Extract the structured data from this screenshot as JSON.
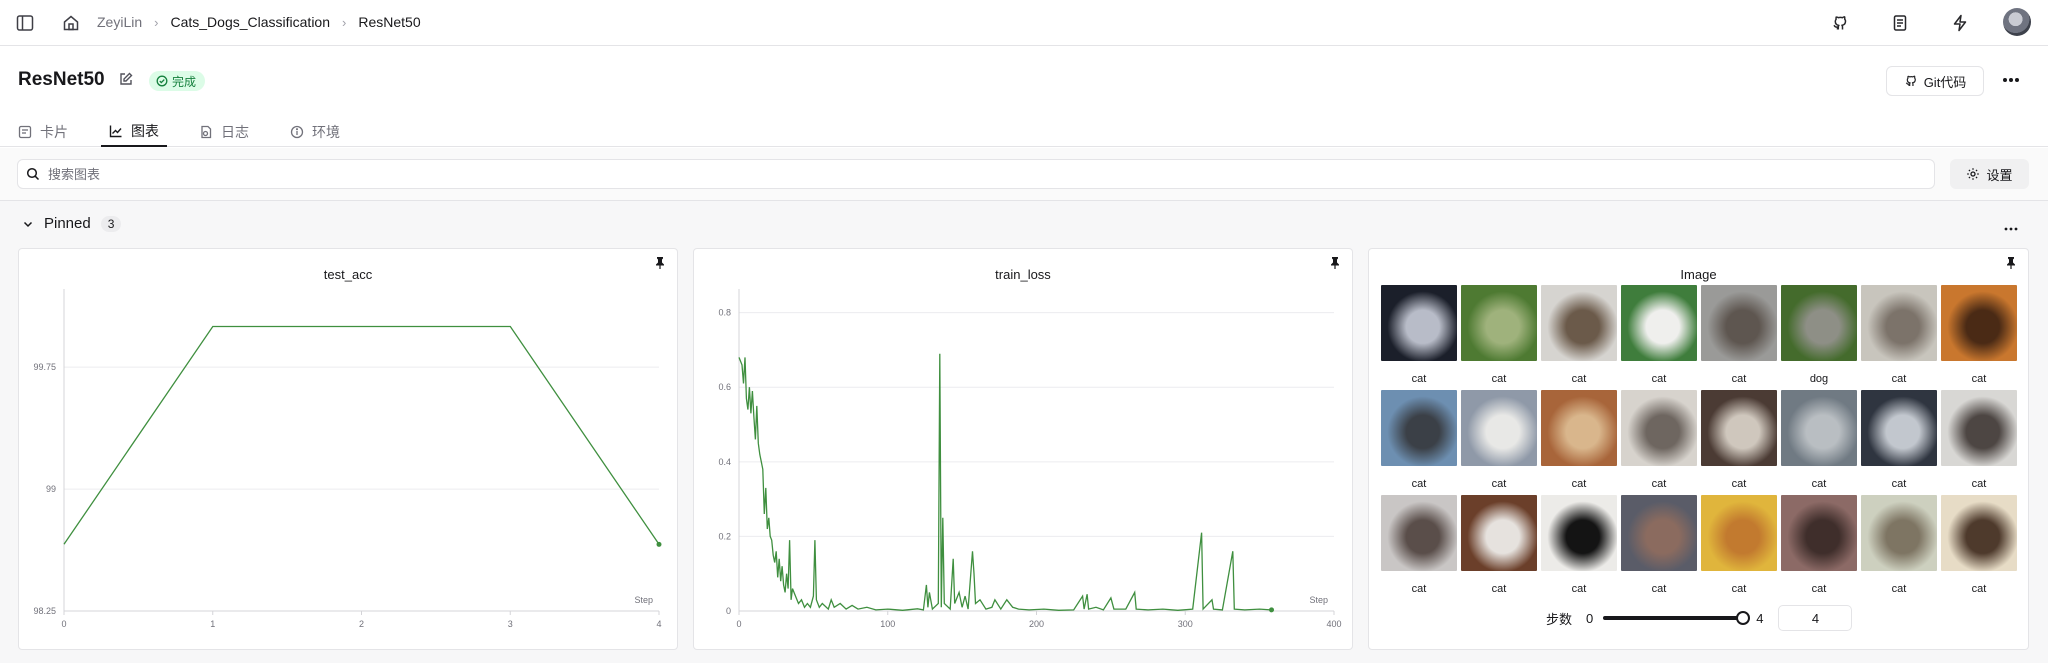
{
  "breadcrumb": {
    "user": "ZeyiLin",
    "project": "Cats_Dogs_Classification",
    "experiment": "ResNet50"
  },
  "header": {
    "title": "ResNet50",
    "status": "完成",
    "git_label": "Git代码"
  },
  "tabs": [
    {
      "label": "卡片"
    },
    {
      "label": "图表"
    },
    {
      "label": "日志"
    },
    {
      "label": "环境"
    }
  ],
  "search": {
    "placeholder": "搜索图表",
    "settings_label": "设置"
  },
  "section": {
    "title": "Pinned",
    "count": "3"
  },
  "colors": {
    "line": "#3f8f3f",
    "status_bg": "#dcfce7",
    "status_fg": "#15803d"
  },
  "chart_data": [
    {
      "type": "line",
      "title": "test_acc",
      "xlabel": "Step",
      "x": [
        0,
        1,
        2,
        3,
        4
      ],
      "y": [
        98.66,
        100.0,
        100.0,
        100.0,
        98.66
      ],
      "xlim": [
        0,
        4
      ],
      "ylim": [
        98.25,
        100.2
      ],
      "yticks": [
        "99.75",
        "99",
        "98.25"
      ],
      "xticks": [
        "0",
        "1",
        "2",
        "3",
        "4"
      ],
      "grid": true
    },
    {
      "type": "line",
      "title": "train_loss",
      "xlabel": "Step",
      "xlim": [
        0,
        400
      ],
      "ylim": [
        0,
        0.85
      ],
      "yticks": [
        "0.8",
        "0.6",
        "0.4",
        "0.2",
        "0"
      ],
      "xticks": [
        "0",
        "100",
        "200",
        "300",
        "400"
      ],
      "grid": true,
      "points": [
        [
          0,
          0.68
        ],
        [
          2,
          0.66
        ],
        [
          3,
          0.61
        ],
        [
          4,
          0.68
        ],
        [
          5,
          0.57
        ],
        [
          6,
          0.54
        ],
        [
          7,
          0.6
        ],
        [
          8,
          0.53
        ],
        [
          9,
          0.59
        ],
        [
          10,
          0.52
        ],
        [
          11,
          0.46
        ],
        [
          12,
          0.55
        ],
        [
          13,
          0.45
        ],
        [
          14,
          0.42
        ],
        [
          15,
          0.4
        ],
        [
          16,
          0.38
        ],
        [
          17,
          0.26
        ],
        [
          18,
          0.33
        ],
        [
          19,
          0.22
        ],
        [
          20,
          0.25
        ],
        [
          21,
          0.2
        ],
        [
          22,
          0.19
        ],
        [
          23,
          0.15
        ],
        [
          24,
          0.13
        ],
        [
          25,
          0.16
        ],
        [
          26,
          0.09
        ],
        [
          27,
          0.14
        ],
        [
          28,
          0.08
        ],
        [
          29,
          0.12
        ],
        [
          30,
          0.07
        ],
        [
          31,
          0.05
        ],
        [
          32,
          0.1
        ],
        [
          33,
          0.06
        ],
        [
          34,
          0.19
        ],
        [
          35,
          0.03
        ],
        [
          36,
          0.06
        ],
        [
          38,
          0.04
        ],
        [
          40,
          0.02
        ],
        [
          42,
          0.03
        ],
        [
          44,
          0.01
        ],
        [
          46,
          0.02
        ],
        [
          48,
          0.01
        ],
        [
          50,
          0.04
        ],
        [
          51,
          0.19
        ],
        [
          52,
          0.03
        ],
        [
          54,
          0.01
        ],
        [
          56,
          0.02
        ],
        [
          60,
          0.005
        ],
        [
          62,
          0.03
        ],
        [
          64,
          0.01
        ],
        [
          68,
          0.02
        ],
        [
          72,
          0.005
        ],
        [
          76,
          0.015
        ],
        [
          80,
          0.005
        ],
        [
          86,
          0.01
        ],
        [
          92,
          0.003
        ],
        [
          100,
          0.005
        ],
        [
          110,
          0.002
        ],
        [
          120,
          0.006
        ],
        [
          124,
          0.003
        ],
        [
          126,
          0.07
        ],
        [
          127,
          0.01
        ],
        [
          128,
          0.05
        ],
        [
          130,
          0.005
        ],
        [
          134,
          0.02
        ],
        [
          135,
          0.69
        ],
        [
          136,
          0.01
        ],
        [
          137,
          0.25
        ],
        [
          138,
          0.02
        ],
        [
          142,
          0.005
        ],
        [
          144,
          0.14
        ],
        [
          145,
          0.02
        ],
        [
          148,
          0.05
        ],
        [
          150,
          0.01
        ],
        [
          152,
          0.04
        ],
        [
          154,
          0.005
        ],
        [
          157,
          0.16
        ],
        [
          158,
          0.1
        ],
        [
          159,
          0.02
        ],
        [
          162,
          0.03
        ],
        [
          166,
          0.005
        ],
        [
          170,
          0.01
        ],
        [
          172,
          0.03
        ],
        [
          176,
          0.005
        ],
        [
          180,
          0.03
        ],
        [
          184,
          0.01
        ],
        [
          188,
          0.005
        ],
        [
          195,
          0.003
        ],
        [
          205,
          0.005
        ],
        [
          215,
          0.002
        ],
        [
          225,
          0.003
        ],
        [
          231,
          0.04
        ],
        [
          232,
          0.005
        ],
        [
          234,
          0.045
        ],
        [
          235,
          0.005
        ],
        [
          240,
          0.01
        ],
        [
          245,
          0.003
        ],
        [
          250,
          0.035
        ],
        [
          252,
          0.005
        ],
        [
          260,
          0.005
        ],
        [
          266,
          0.05
        ],
        [
          267,
          0.005
        ],
        [
          275,
          0.003
        ],
        [
          285,
          0.005
        ],
        [
          295,
          0.002
        ],
        [
          305,
          0.005
        ],
        [
          311,
          0.21
        ],
        [
          312,
          0.005
        ],
        [
          318,
          0.03
        ],
        [
          319,
          0.005
        ],
        [
          325,
          0.003
        ],
        [
          332,
          0.16
        ],
        [
          333,
          0.005
        ],
        [
          340,
          0.003
        ],
        [
          350,
          0.005
        ],
        [
          358,
          0.003
        ]
      ]
    }
  ],
  "image_panel": {
    "title": "Image",
    "images": [
      {
        "label": "cat",
        "c1": "#1b1f2a",
        "c2": "#b8bcc8"
      },
      {
        "label": "cat",
        "c1": "#4e7a32",
        "c2": "#9fb27c"
      },
      {
        "label": "cat",
        "c1": "#d6d4d0",
        "c2": "#6b5a4a"
      },
      {
        "label": "cat",
        "c1": "#3f7d3c",
        "c2": "#efefed"
      },
      {
        "label": "cat",
        "c1": "#9a9a98",
        "c2": "#5e5650"
      },
      {
        "label": "dog",
        "c1": "#446b2c",
        "c2": "#8e8f86"
      },
      {
        "label": "cat",
        "c1": "#c8c5bd",
        "c2": "#7c736a"
      },
      {
        "label": "cat",
        "c1": "#c9772e",
        "c2": "#4a2a15"
      },
      {
        "label": "cat",
        "c1": "#6d8fb1",
        "c2": "#3b4047"
      },
      {
        "label": "cat",
        "c1": "#8f99a8",
        "c2": "#e8e8e6"
      },
      {
        "label": "cat",
        "c1": "#a8653a",
        "c2": "#d9b68c"
      },
      {
        "label": "cat",
        "c1": "#d7d3cd",
        "c2": "#6e6660"
      },
      {
        "label": "cat",
        "c1": "#4b3b34",
        "c2": "#cfc7bd"
      },
      {
        "label": "cat",
        "c1": "#707a83",
        "c2": "#b9bec2"
      },
      {
        "label": "cat",
        "c1": "#2f3540",
        "c2": "#c2c7ce"
      },
      {
        "label": "cat",
        "c1": "#d8d7d4",
        "c2": "#4d4643"
      },
      {
        "label": "cat",
        "c1": "#c9c6c5",
        "c2": "#5a4e4a"
      },
      {
        "label": "cat",
        "c1": "#6b3f2a",
        "c2": "#e6e2de"
      },
      {
        "label": "cat",
        "c1": "#ecebe8",
        "c2": "#141414"
      },
      {
        "label": "cat",
        "c1": "#5a5c68",
        "c2": "#8b6b5f"
      },
      {
        "label": "cat",
        "c1": "#e0b53c",
        "c2": "#c27a2f"
      },
      {
        "label": "cat",
        "c1": "#8c6a66",
        "c2": "#3f2e2b"
      },
      {
        "label": "cat",
        "c1": "#cdd0bf",
        "c2": "#7e7563"
      },
      {
        "label": "cat",
        "c1": "#e7dcc6",
        "c2": "#4e3a2c"
      }
    ],
    "step_label": "步数",
    "step_min": "0",
    "step_max": "4",
    "step_value": "4"
  }
}
